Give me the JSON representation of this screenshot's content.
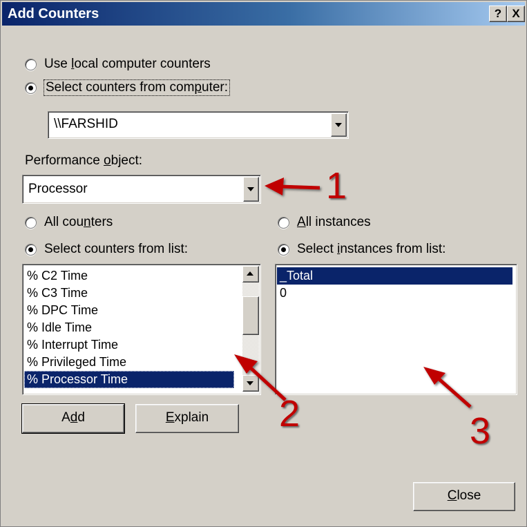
{
  "window": {
    "title": "Add Counters",
    "help_button": "?",
    "close_button": "X"
  },
  "computer_choice": {
    "local_option": {
      "pre": "Use ",
      "key": "l",
      "post": "ocal computer counters"
    },
    "remote_option": {
      "pre": "Select counters from com",
      "key": "p",
      "post": "uter:"
    },
    "selected": "remote"
  },
  "computer_combo": {
    "value": "\\\\FARSHID"
  },
  "performance_object": {
    "label": {
      "pre": "Performance ",
      "key": "o",
      "post": "bject:"
    },
    "value": "Processor"
  },
  "counters": {
    "all_option": {
      "pre": "All cou",
      "key": "n",
      "post": "ters"
    },
    "list_option": {
      "pre": "Select counters from list:"
    },
    "selected_option": "list",
    "items": [
      "% C2 Time",
      "% C3 Time",
      "% DPC Time",
      "% Idle Time",
      "% Interrupt Time",
      "% Privileged Time",
      "% Processor Time"
    ],
    "selected_item": "% Processor Time"
  },
  "instances": {
    "all_option": {
      "pre": "",
      "key": "A",
      "post": "ll instances"
    },
    "list_option": {
      "pre": "Select ",
      "key": "i",
      "post": "nstances from list:"
    },
    "selected_option": "list",
    "items": [
      "_Total",
      "0"
    ],
    "selected_item": "_Total"
  },
  "buttons": {
    "add": {
      "pre": "A",
      "key": "d",
      "post": "d"
    },
    "explain": {
      "pre": "",
      "key": "E",
      "post": "xplain"
    },
    "close": {
      "pre": "",
      "key": "C",
      "post": "lose"
    }
  },
  "annotations": {
    "color": "#c00000",
    "labels": [
      "1",
      "2",
      "3"
    ]
  }
}
